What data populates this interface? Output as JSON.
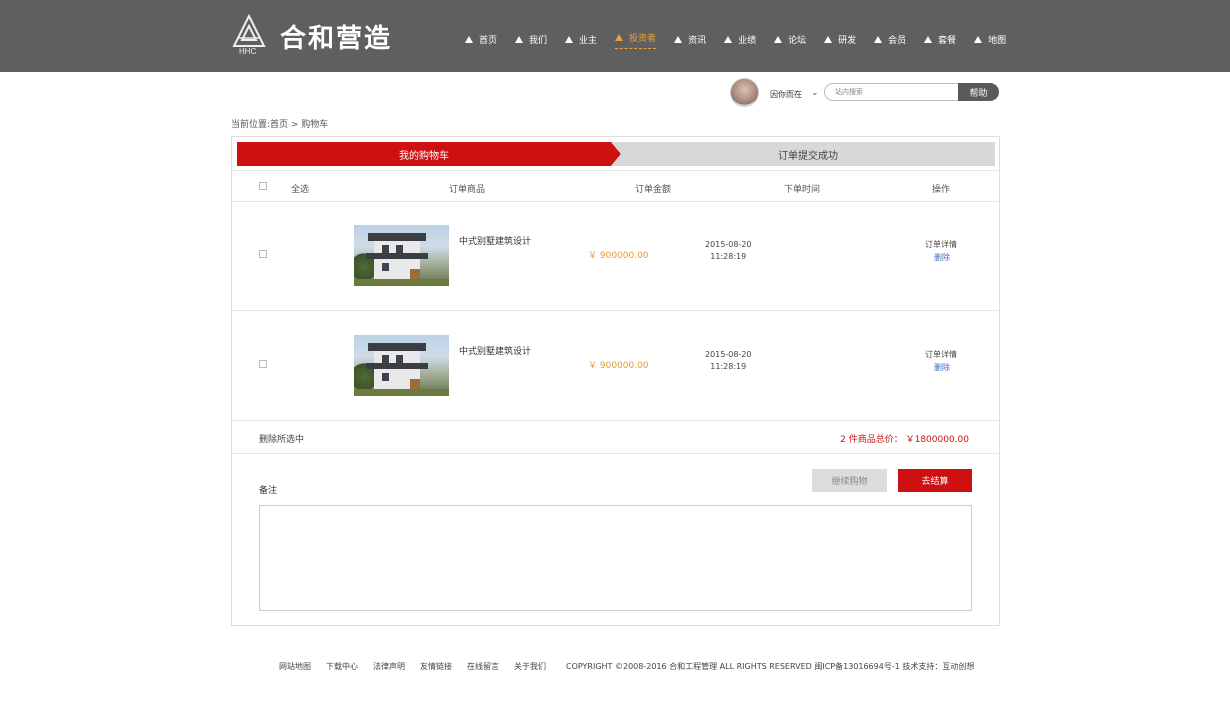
{
  "header": {
    "logo_text": "合和营造",
    "logo_sub": "HHC",
    "nav": [
      {
        "label": "首页",
        "active": false
      },
      {
        "label": "我们",
        "active": false
      },
      {
        "label": "业主",
        "active": false
      },
      {
        "label": "投资者",
        "active": true
      },
      {
        "label": "资讯",
        "active": false
      },
      {
        "label": "业绩",
        "active": false
      },
      {
        "label": "论坛",
        "active": false
      },
      {
        "label": "研发",
        "active": false
      },
      {
        "label": "会员",
        "active": false
      },
      {
        "label": "套餐",
        "active": false
      },
      {
        "label": "地图",
        "active": false
      }
    ],
    "active_color": "#e8a33a"
  },
  "userbar": {
    "username": "因你而在",
    "search_placeholder": "站内搜索",
    "help_label": "帮助"
  },
  "breadcrumb": "当前位置:首页 > 购物车",
  "steps": {
    "step1": "我的购物车",
    "step2": "订单提交成功"
  },
  "table": {
    "headers": {
      "select_all": "全选",
      "product": "订单商品",
      "amount": "订单金额",
      "time": "下单时间",
      "action": "操作"
    },
    "rows": [
      {
        "name": "中式别墅建筑设计",
        "price": "￥ 900000.00",
        "date": "2015-08-20",
        "time": "11:28:19",
        "detail": "订单详情",
        "delete": "删除"
      },
      {
        "name": "中式别墅建筑设计",
        "price": "￥ 900000.00",
        "date": "2015-08-20",
        "time": "11:28:19",
        "detail": "订单详情",
        "delete": "删除"
      }
    ]
  },
  "summary": {
    "delete_selected": "删除所选中",
    "total": "2 件商品总价： ￥1800000.00"
  },
  "remark_label": "备注",
  "buttons": {
    "continue": "继续购物",
    "checkout": "去结算"
  },
  "footer": {
    "links": [
      "网站地图",
      "下载中心",
      "法律声明",
      "友情链接",
      "在线留言",
      "关于我们"
    ],
    "copyright": "COPYRIGHT  ©2008-2016  合和工程管理 ALL RIGHTS RESERVED 闽ICP备13016694号-1  技术支持：互动创想"
  },
  "colors": {
    "header_bg": "#5f5f5f",
    "primary_red": "#cf1010",
    "price_orange": "#e89a2a"
  }
}
